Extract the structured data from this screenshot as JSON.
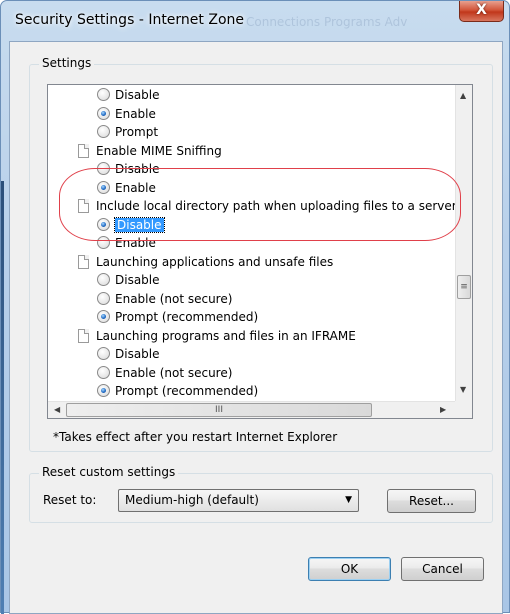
{
  "window": {
    "title": "Security Settings - Internet Zone",
    "close_label": "X",
    "ghost_tabs": "Connections  Programs  Adv"
  },
  "settings_group": {
    "label": "Settings"
  },
  "list_items": [
    {
      "kind": "radio",
      "label": "Disable",
      "checked": false
    },
    {
      "kind": "radio",
      "label": "Enable",
      "checked": true
    },
    {
      "kind": "radio",
      "label": "Prompt",
      "checked": false
    },
    {
      "kind": "header",
      "label": "Enable MIME Sniffing"
    },
    {
      "kind": "radio",
      "label": "Disable",
      "checked": false
    },
    {
      "kind": "radio",
      "label": "Enable",
      "checked": true
    },
    {
      "kind": "header",
      "label": "Include local directory path when uploading files to a server"
    },
    {
      "kind": "radio",
      "label": "Disable",
      "checked": true,
      "selected": true
    },
    {
      "kind": "radio",
      "label": "Enable",
      "checked": false
    },
    {
      "kind": "header",
      "label": "Launching applications and unsafe files"
    },
    {
      "kind": "radio",
      "label": "Disable",
      "checked": false
    },
    {
      "kind": "radio",
      "label": "Enable (not secure)",
      "checked": false
    },
    {
      "kind": "radio",
      "label": "Prompt (recommended)",
      "checked": true
    },
    {
      "kind": "header",
      "label": "Launching programs and files in an IFRAME"
    },
    {
      "kind": "radio",
      "label": "Disable",
      "checked": false
    },
    {
      "kind": "radio",
      "label": "Enable (not secure)",
      "checked": false
    },
    {
      "kind": "radio",
      "label": "Prompt (recommended)",
      "checked": true
    }
  ],
  "scrollbar": {
    "thumb_glyph": "≡",
    "hthumb_glyph": "III"
  },
  "note": "*Takes effect after you restart Internet Explorer",
  "reset_group": {
    "label": "Reset custom settings",
    "reset_to_label": "Reset to:",
    "selected_value": "Medium-high (default)",
    "reset_button": "Reset..."
  },
  "buttons": {
    "ok": "OK",
    "cancel": "Cancel"
  }
}
